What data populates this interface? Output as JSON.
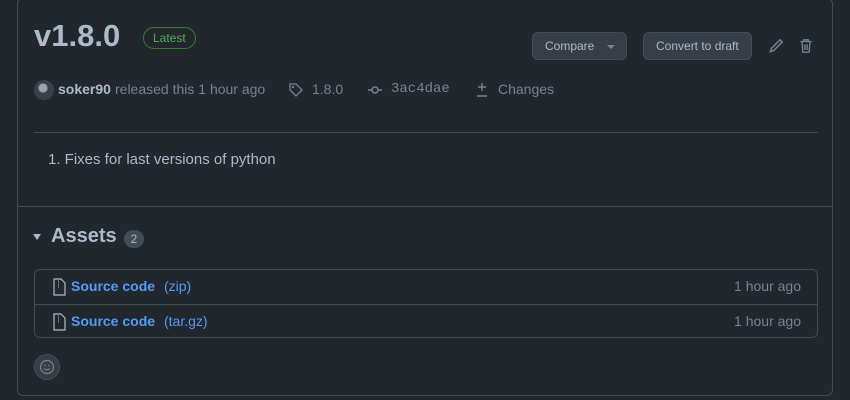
{
  "release": {
    "title": "v1.8.0",
    "badge": "Latest",
    "compare_label": "Compare",
    "convert_label": "Convert to draft",
    "user": "soker90",
    "released_text": "released this 1 hour ago",
    "tag": "1.8.0",
    "commit": "3ac4dae",
    "changes_label": "Changes",
    "notes": [
      "1. Fixes for last versions of python"
    ]
  },
  "assets": {
    "title": "Assets",
    "count": "2",
    "items": [
      {
        "name": "Source code",
        "ext": "(zip)",
        "time": "1 hour ago"
      },
      {
        "name": "Source code",
        "ext": "(tar.gz)",
        "time": "1 hour ago"
      }
    ]
  },
  "icons": {
    "edit": "pencil-icon",
    "delete": "trash-icon",
    "tag": "tag-icon",
    "commit": "git-commit-icon",
    "diff": "diff-icon",
    "file": "file-zip-icon",
    "reaction": "smiley-icon"
  },
  "colors": {
    "background": "#22272e",
    "border": "#444c56",
    "link": "#539bf5",
    "latest": "#57ab5a",
    "text": "#adbac7",
    "muted": "#768390"
  }
}
